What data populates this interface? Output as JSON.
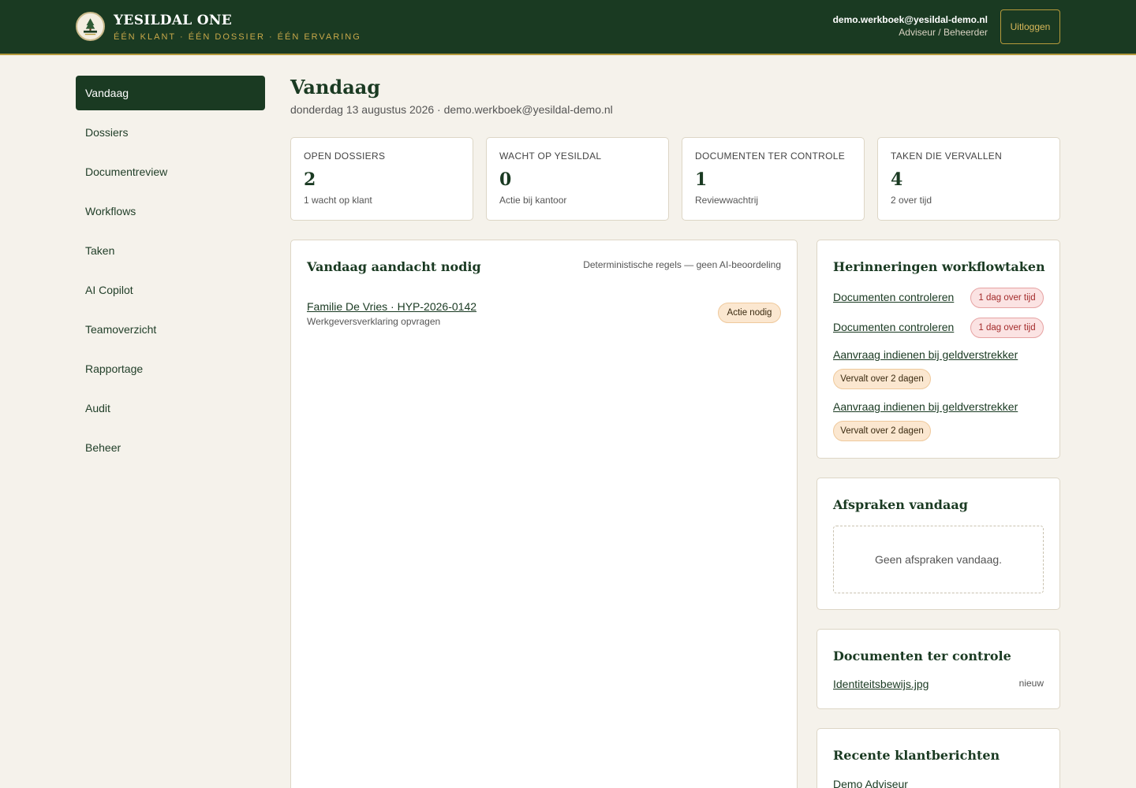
{
  "header": {
    "brand_title": "YESILDAL ONE",
    "brand_tagline": "ÉÉN KLANT · ÉÉN DOSSIER · ÉÉN ERVARING",
    "user_email": "demo.werkboek@yesildal-demo.nl",
    "user_role": "Adviseur / Beheerder",
    "logout_label": "Uitloggen"
  },
  "sidebar": {
    "items": [
      {
        "label": "Vandaag",
        "active": true
      },
      {
        "label": "Dossiers"
      },
      {
        "label": "Documentreview"
      },
      {
        "label": "Workflows"
      },
      {
        "label": "Taken"
      },
      {
        "label": "AI Copilot"
      },
      {
        "label": "Teamoverzicht"
      },
      {
        "label": "Rapportage"
      },
      {
        "label": "Audit"
      },
      {
        "label": "Beheer"
      }
    ]
  },
  "page": {
    "title": "Vandaag",
    "subtitle": "donderdag 13 augustus 2026 · demo.werkboek@yesildal-demo.nl"
  },
  "stats": [
    {
      "label": "OPEN DOSSIERS",
      "value": "2",
      "note": "1 wacht op klant"
    },
    {
      "label": "WACHT OP YESILDAL",
      "value": "0",
      "note": "Actie bij kantoor"
    },
    {
      "label": "DOCUMENTEN TER CONTROLE",
      "value": "1",
      "note": "Reviewwachtrij"
    },
    {
      "label": "TAKEN DIE VERVALLEN",
      "value": "4",
      "note": "2 over tijd"
    }
  ],
  "attention": {
    "title": "Vandaag aandacht nodig",
    "meta": "Deterministische regels — geen AI-beoordeling",
    "items": [
      {
        "title": "Familie De Vries · HYP-2026-0142",
        "subtitle": "Werkgeversverklaring opvragen",
        "badge": "Actie nodig"
      }
    ]
  },
  "reminders": {
    "title": "Herinneringen workflowtaken",
    "items": [
      {
        "label": "Documenten controleren",
        "badge": "1 dag over tijd"
      },
      {
        "label": "Documenten controleren",
        "badge": "1 dag over tijd"
      },
      {
        "label": "Aanvraag indienen bij geldverstrekker",
        "badge": "Vervalt over 2 dagen"
      },
      {
        "label": "Aanvraag indienen bij geldverstrekker",
        "badge": "Vervalt over 2 dagen"
      }
    ]
  },
  "appointments": {
    "title": "Afspraken vandaag",
    "empty": "Geen afspraken vandaag."
  },
  "documents": {
    "title": "Documenten ter controle",
    "items": [
      {
        "name": "Identiteitsbewijs.jpg",
        "status": "nieuw"
      }
    ]
  },
  "messages": {
    "title": "Recente klantberichten",
    "items": [
      {
        "sender": "Demo Adviseur"
      }
    ]
  },
  "colors": {
    "brand_dark_green": "#1a3a22",
    "gold": "#b59a3c",
    "background": "#f5f2eb",
    "overdue_red": "#a32b2b",
    "due_orange": "#fbe7d0"
  }
}
